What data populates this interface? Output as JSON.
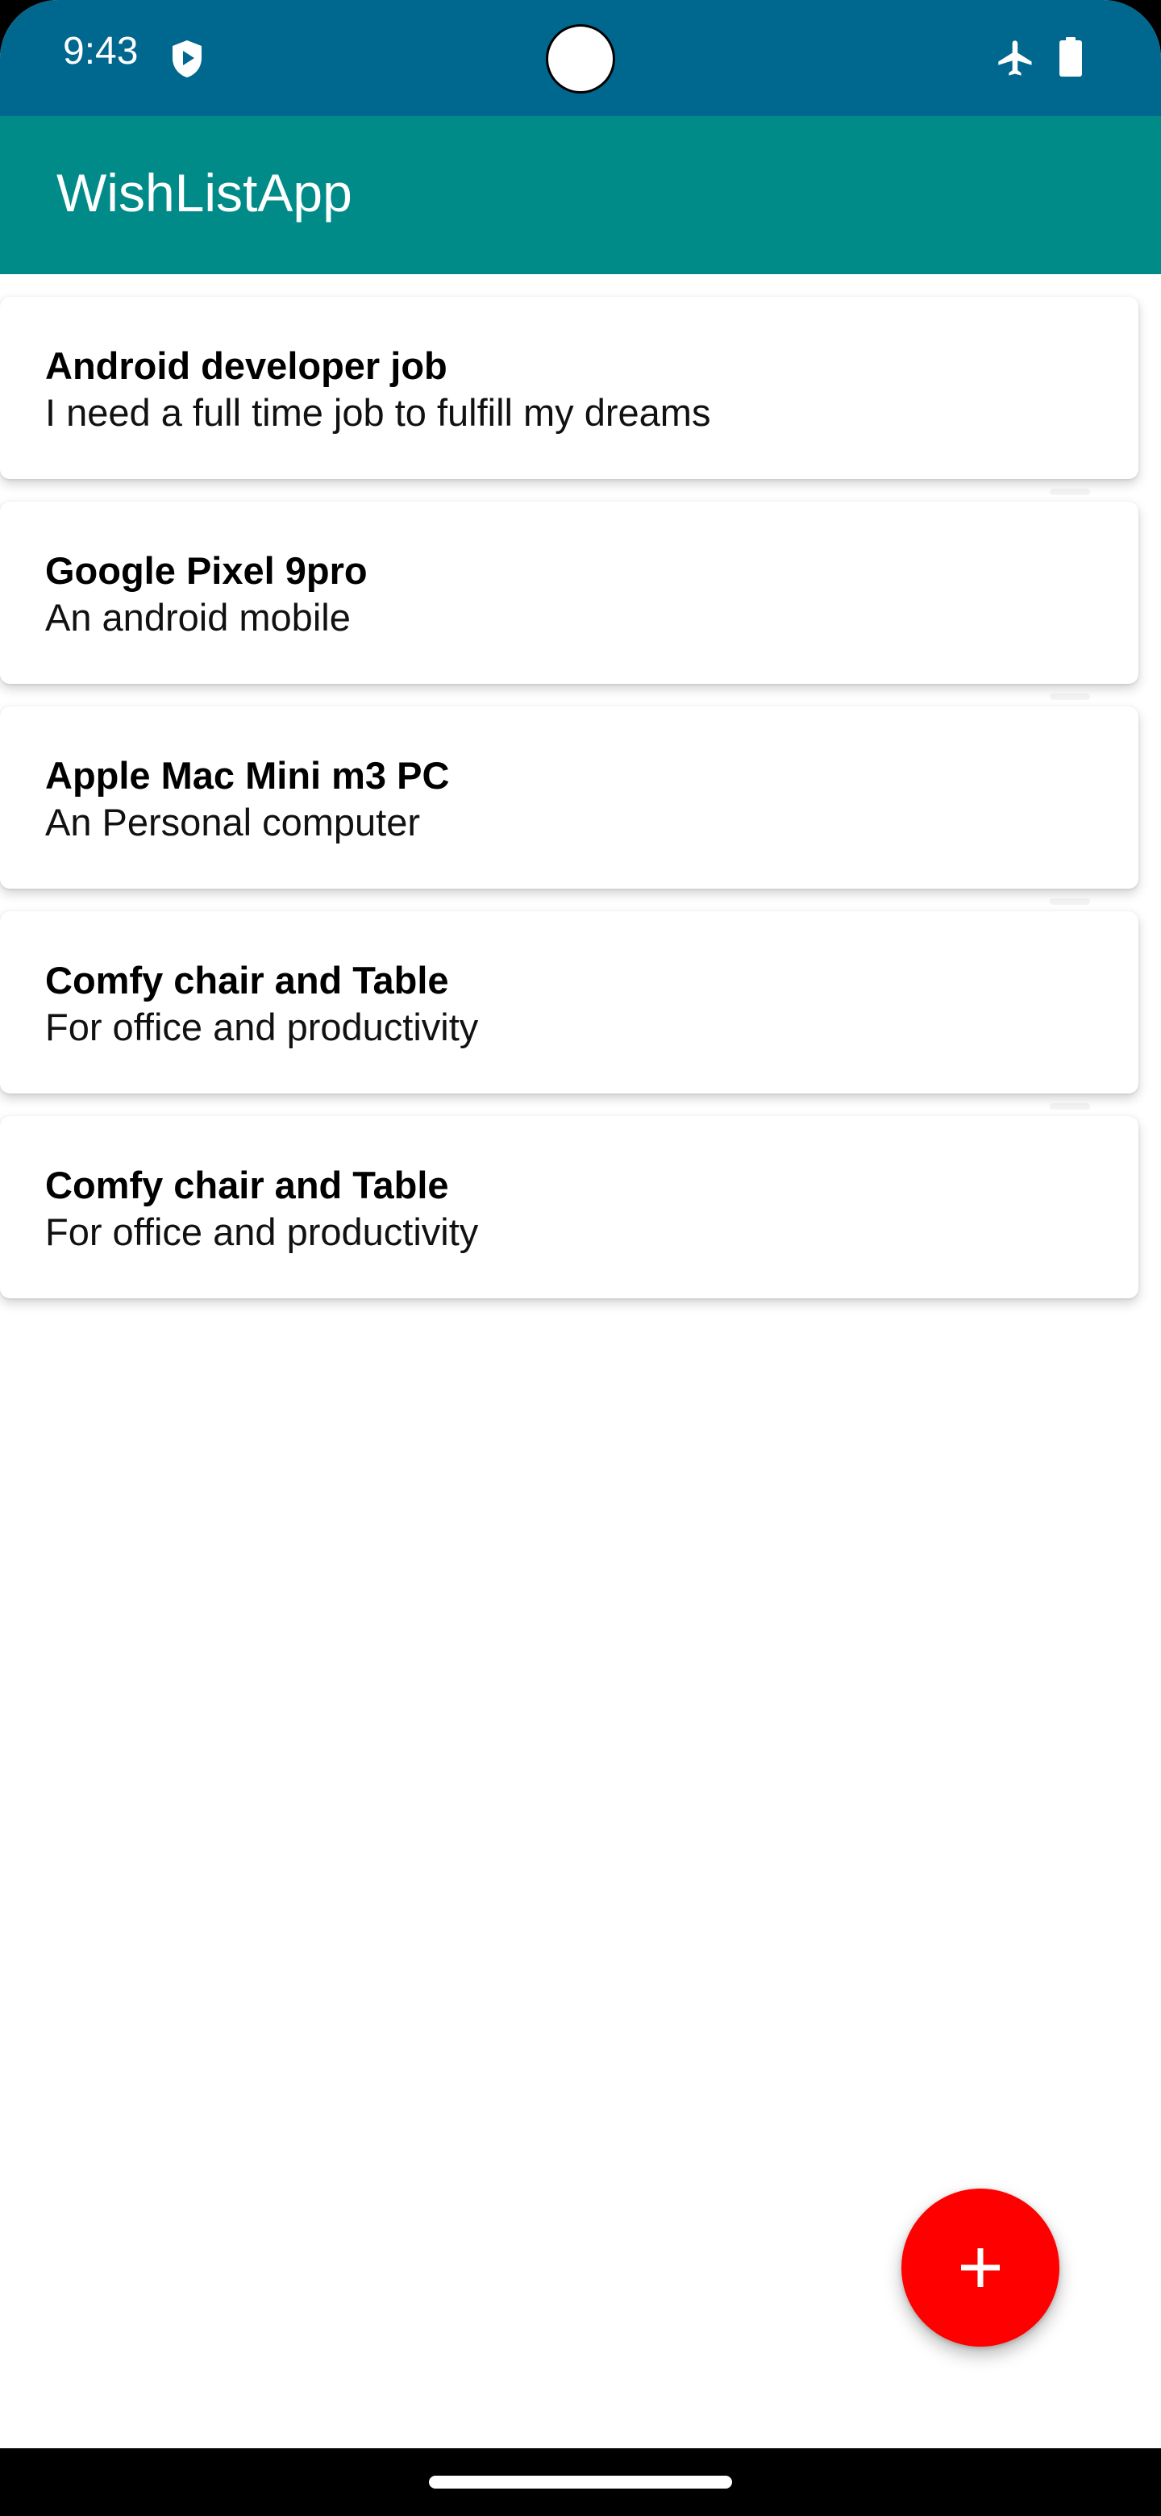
{
  "status_bar": {
    "time": "9:43",
    "icons": [
      "shield-icon",
      "airplane-icon",
      "battery-icon"
    ],
    "background": "#00678f"
  },
  "app_bar": {
    "title": "WishListApp",
    "background": "#008b89"
  },
  "wishes": [
    {
      "title": "Android developer job",
      "description": "I need a full time job to fulfill my dreams"
    },
    {
      "title": "Google Pixel 9pro",
      "description": "An android mobile"
    },
    {
      "title": "Apple Mac Mini m3 PC",
      "description": "An Personal computer"
    },
    {
      "title": "Comfy chair and Table",
      "description": "For office and productivity"
    },
    {
      "title": "Comfy chair and Table",
      "description": "For office and productivity"
    }
  ],
  "fab": {
    "icon": "add-icon",
    "color": "#ff0000"
  }
}
